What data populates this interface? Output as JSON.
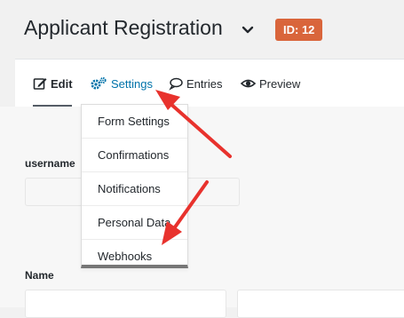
{
  "header": {
    "title": "Applicant Registration",
    "id_badge": "ID: 12"
  },
  "tabs": {
    "edit": "Edit",
    "settings": "Settings",
    "entries": "Entries",
    "preview": "Preview"
  },
  "settings_menu": {
    "items": [
      "Form Settings",
      "Confirmations",
      "Notifications",
      "Personal Data",
      "Webhooks"
    ]
  },
  "form": {
    "username_label": "username",
    "name_label": "Name"
  },
  "colors": {
    "badge": "#d9653b",
    "link": "#0073aa",
    "annotation_arrow": "#e8322d"
  }
}
